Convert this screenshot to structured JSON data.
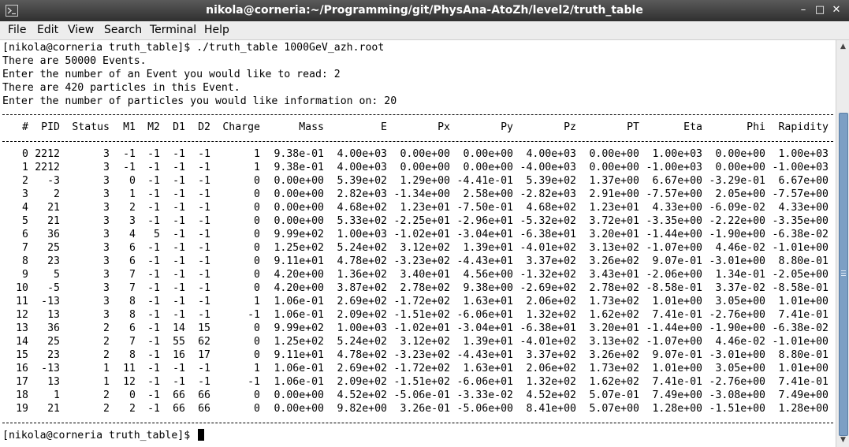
{
  "window": {
    "title": "nikola@corneria:~/Programming/git/PhysAna-AtoZh/level2/truth_table",
    "app_icon": "terminal-icon",
    "controls": {
      "minimize": "–",
      "maximize": "□",
      "close": "✕"
    }
  },
  "menubar": {
    "items": [
      "File",
      "Edit",
      "View",
      "Search",
      "Terminal",
      "Help"
    ]
  },
  "terminal": {
    "output_lines": [
      "[nikola@corneria truth_table]$ ./truth_table 1000GeV_azh.root",
      "There are 50000 Events.",
      "Enter the number of an Event you would like to read: 2",
      "There are 420 particles in this Event.",
      "Enter the number of particles you would like information on: 20"
    ],
    "table": {
      "columns": [
        "#",
        "PID",
        "Status",
        "M1",
        "M2",
        "D1",
        "D2",
        "Charge",
        "Mass",
        "E",
        "Px",
        "Py",
        "Pz",
        "PT",
        "Eta",
        "Phi",
        "Rapidity"
      ],
      "rows": [
        [
          "0",
          "2212",
          "3",
          "-1",
          "-1",
          "-1",
          "-1",
          "1",
          "9.38e-01",
          "4.00e+03",
          "0.00e+00",
          "0.00e+00",
          "4.00e+03",
          "0.00e+00",
          "1.00e+03",
          "0.00e+00",
          "1.00e+03"
        ],
        [
          "1",
          "2212",
          "3",
          "-1",
          "-1",
          "-1",
          "-1",
          "1",
          "9.38e-01",
          "4.00e+03",
          "0.00e+00",
          "0.00e+00",
          "-4.00e+03",
          "0.00e+00",
          "-1.00e+03",
          "0.00e+00",
          "-1.00e+03"
        ],
        [
          "2",
          "-3",
          "3",
          "0",
          "-1",
          "-1",
          "-1",
          "0",
          "0.00e+00",
          "5.39e+02",
          "1.29e+00",
          "-4.41e-01",
          "5.39e+02",
          "1.37e+00",
          "6.67e+00",
          "-3.29e-01",
          "6.67e+00"
        ],
        [
          "3",
          "2",
          "3",
          "1",
          "-1",
          "-1",
          "-1",
          "0",
          "0.00e+00",
          "2.82e+03",
          "-1.34e+00",
          "2.58e+00",
          "-2.82e+03",
          "2.91e+00",
          "-7.57e+00",
          "2.05e+00",
          "-7.57e+00"
        ],
        [
          "4",
          "21",
          "3",
          "2",
          "-1",
          "-1",
          "-1",
          "0",
          "0.00e+00",
          "4.68e+02",
          "1.23e+01",
          "-7.50e-01",
          "4.68e+02",
          "1.23e+01",
          "4.33e+00",
          "-6.09e-02",
          "4.33e+00"
        ],
        [
          "5",
          "21",
          "3",
          "3",
          "-1",
          "-1",
          "-1",
          "0",
          "0.00e+00",
          "5.33e+02",
          "-2.25e+01",
          "-2.96e+01",
          "-5.32e+02",
          "3.72e+01",
          "-3.35e+00",
          "-2.22e+00",
          "-3.35e+00"
        ],
        [
          "6",
          "36",
          "3",
          "4",
          "5",
          "-1",
          "-1",
          "0",
          "9.99e+02",
          "1.00e+03",
          "-1.02e+01",
          "-3.04e+01",
          "-6.38e+01",
          "3.20e+01",
          "-1.44e+00",
          "-1.90e+00",
          "-6.38e-02"
        ],
        [
          "7",
          "25",
          "3",
          "6",
          "-1",
          "-1",
          "-1",
          "0",
          "1.25e+02",
          "5.24e+02",
          "3.12e+02",
          "1.39e+01",
          "-4.01e+02",
          "3.13e+02",
          "-1.07e+00",
          "4.46e-02",
          "-1.01e+00"
        ],
        [
          "8",
          "23",
          "3",
          "6",
          "-1",
          "-1",
          "-1",
          "0",
          "9.11e+01",
          "4.78e+02",
          "-3.23e+02",
          "-4.43e+01",
          "3.37e+02",
          "3.26e+02",
          "9.07e-01",
          "-3.01e+00",
          "8.80e-01"
        ],
        [
          "9",
          "5",
          "3",
          "7",
          "-1",
          "-1",
          "-1",
          "0",
          "4.20e+00",
          "1.36e+02",
          "3.40e+01",
          "4.56e+00",
          "-1.32e+02",
          "3.43e+01",
          "-2.06e+00",
          "1.34e-01",
          "-2.05e+00"
        ],
        [
          "10",
          "-5",
          "3",
          "7",
          "-1",
          "-1",
          "-1",
          "0",
          "4.20e+00",
          "3.87e+02",
          "2.78e+02",
          "9.38e+00",
          "-2.69e+02",
          "2.78e+02",
          "-8.58e-01",
          "3.37e-02",
          "-8.58e-01"
        ],
        [
          "11",
          "-13",
          "3",
          "8",
          "-1",
          "-1",
          "-1",
          "1",
          "1.06e-01",
          "2.69e+02",
          "-1.72e+02",
          "1.63e+01",
          "2.06e+02",
          "1.73e+02",
          "1.01e+00",
          "3.05e+00",
          "1.01e+00"
        ],
        [
          "12",
          "13",
          "3",
          "8",
          "-1",
          "-1",
          "-1",
          "-1",
          "1.06e-01",
          "2.09e+02",
          "-1.51e+02",
          "-6.06e+01",
          "1.32e+02",
          "1.62e+02",
          "7.41e-01",
          "-2.76e+00",
          "7.41e-01"
        ],
        [
          "13",
          "36",
          "2",
          "6",
          "-1",
          "14",
          "15",
          "0",
          "9.99e+02",
          "1.00e+03",
          "-1.02e+01",
          "-3.04e+01",
          "-6.38e+01",
          "3.20e+01",
          "-1.44e+00",
          "-1.90e+00",
          "-6.38e-02"
        ],
        [
          "14",
          "25",
          "2",
          "7",
          "-1",
          "55",
          "62",
          "0",
          "1.25e+02",
          "5.24e+02",
          "3.12e+02",
          "1.39e+01",
          "-4.01e+02",
          "3.13e+02",
          "-1.07e+00",
          "4.46e-02",
          "-1.01e+00"
        ],
        [
          "15",
          "23",
          "2",
          "8",
          "-1",
          "16",
          "17",
          "0",
          "9.11e+01",
          "4.78e+02",
          "-3.23e+02",
          "-4.43e+01",
          "3.37e+02",
          "3.26e+02",
          "9.07e-01",
          "-3.01e+00",
          "8.80e-01"
        ],
        [
          "16",
          "-13",
          "1",
          "11",
          "-1",
          "-1",
          "-1",
          "1",
          "1.06e-01",
          "2.69e+02",
          "-1.72e+02",
          "1.63e+01",
          "2.06e+02",
          "1.73e+02",
          "1.01e+00",
          "3.05e+00",
          "1.01e+00"
        ],
        [
          "17",
          "13",
          "1",
          "12",
          "-1",
          "-1",
          "-1",
          "-1",
          "1.06e-01",
          "2.09e+02",
          "-1.51e+02",
          "-6.06e+01",
          "1.32e+02",
          "1.62e+02",
          "7.41e-01",
          "-2.76e+00",
          "7.41e-01"
        ],
        [
          "18",
          "1",
          "2",
          "0",
          "-1",
          "66",
          "66",
          "0",
          "0.00e+00",
          "4.52e+02",
          "-5.06e-01",
          "-3.33e-02",
          "4.52e+02",
          "5.07e-01",
          "7.49e+00",
          "-3.08e+00",
          "7.49e+00"
        ],
        [
          "19",
          "21",
          "2",
          "2",
          "-1",
          "66",
          "66",
          "0",
          "0.00e+00",
          "9.82e+00",
          "3.26e-01",
          "-5.06e+00",
          "8.41e+00",
          "5.07e+00",
          "1.28e+00",
          "-1.51e+00",
          "1.28e+00"
        ]
      ]
    },
    "prompt": "[nikola@corneria truth_table]$"
  },
  "scrollbar": {
    "up_icon": "arrow-up-icon",
    "down_icon": "arrow-down-icon"
  },
  "colors": {
    "titlebar": "#3c3c3c",
    "scroll_thumb": "#7c9fc4",
    "menubar": "#ededed"
  }
}
